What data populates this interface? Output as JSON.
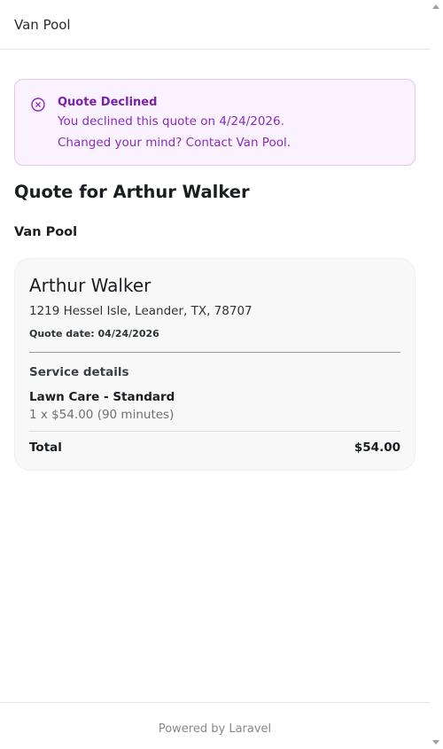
{
  "header": {
    "brand": "Van Pool"
  },
  "alert": {
    "icon": "x-circle-icon",
    "title": "Quote Declined",
    "message": "You declined this quote on 4/24/2026.",
    "contact_line": "Changed your mind? Contact Van Pool.",
    "accent_color": "#7b21a8",
    "background_color": "#faf2ff"
  },
  "page": {
    "title": "Quote for Arthur Walker",
    "company": "Van Pool"
  },
  "quote": {
    "client_name": "Arthur Walker",
    "address": "1219 Hessel Isle, Leander, TX, 78707",
    "quote_date": "Quote date: 04/24/2026",
    "service_heading": "Service details",
    "items": [
      {
        "name": "Lawn Care - Standard",
        "detail": "1 x $54.00 (90 minutes)"
      }
    ],
    "total_label": "Total",
    "total_value": "$54.00"
  },
  "footer": {
    "text": "Powered by Laravel"
  }
}
